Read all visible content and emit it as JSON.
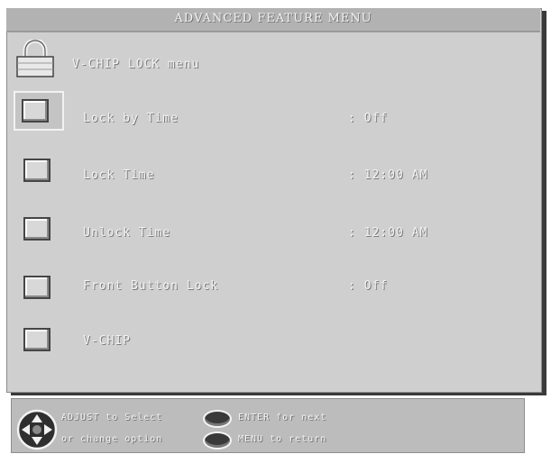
{
  "menu": {
    "title": "ADVANCED FEATURE MENU",
    "header_item": "V-CHIP LOCK menu",
    "items": [
      {
        "label": "Lock by Time",
        "value": ": Off",
        "selected": true
      },
      {
        "label": "Lock Time",
        "value": ": 12:00 AM",
        "selected": false
      },
      {
        "label": "Unlock Time",
        "value": ": 12:00 AM",
        "selected": false
      },
      {
        "label": "Front Button Lock",
        "value": ": Off",
        "selected": false
      },
      {
        "label": "V-CHIP",
        "value": "",
        "selected": false
      }
    ]
  },
  "help": {
    "adjust": "ADJUST to Select",
    "change": "or change option",
    "enter": "ENTER for next",
    "menu": "MENU to return"
  },
  "icons": {
    "lock": "padlock-icon",
    "dpad": "dpad-icon",
    "button": "oval-button-icon"
  }
}
